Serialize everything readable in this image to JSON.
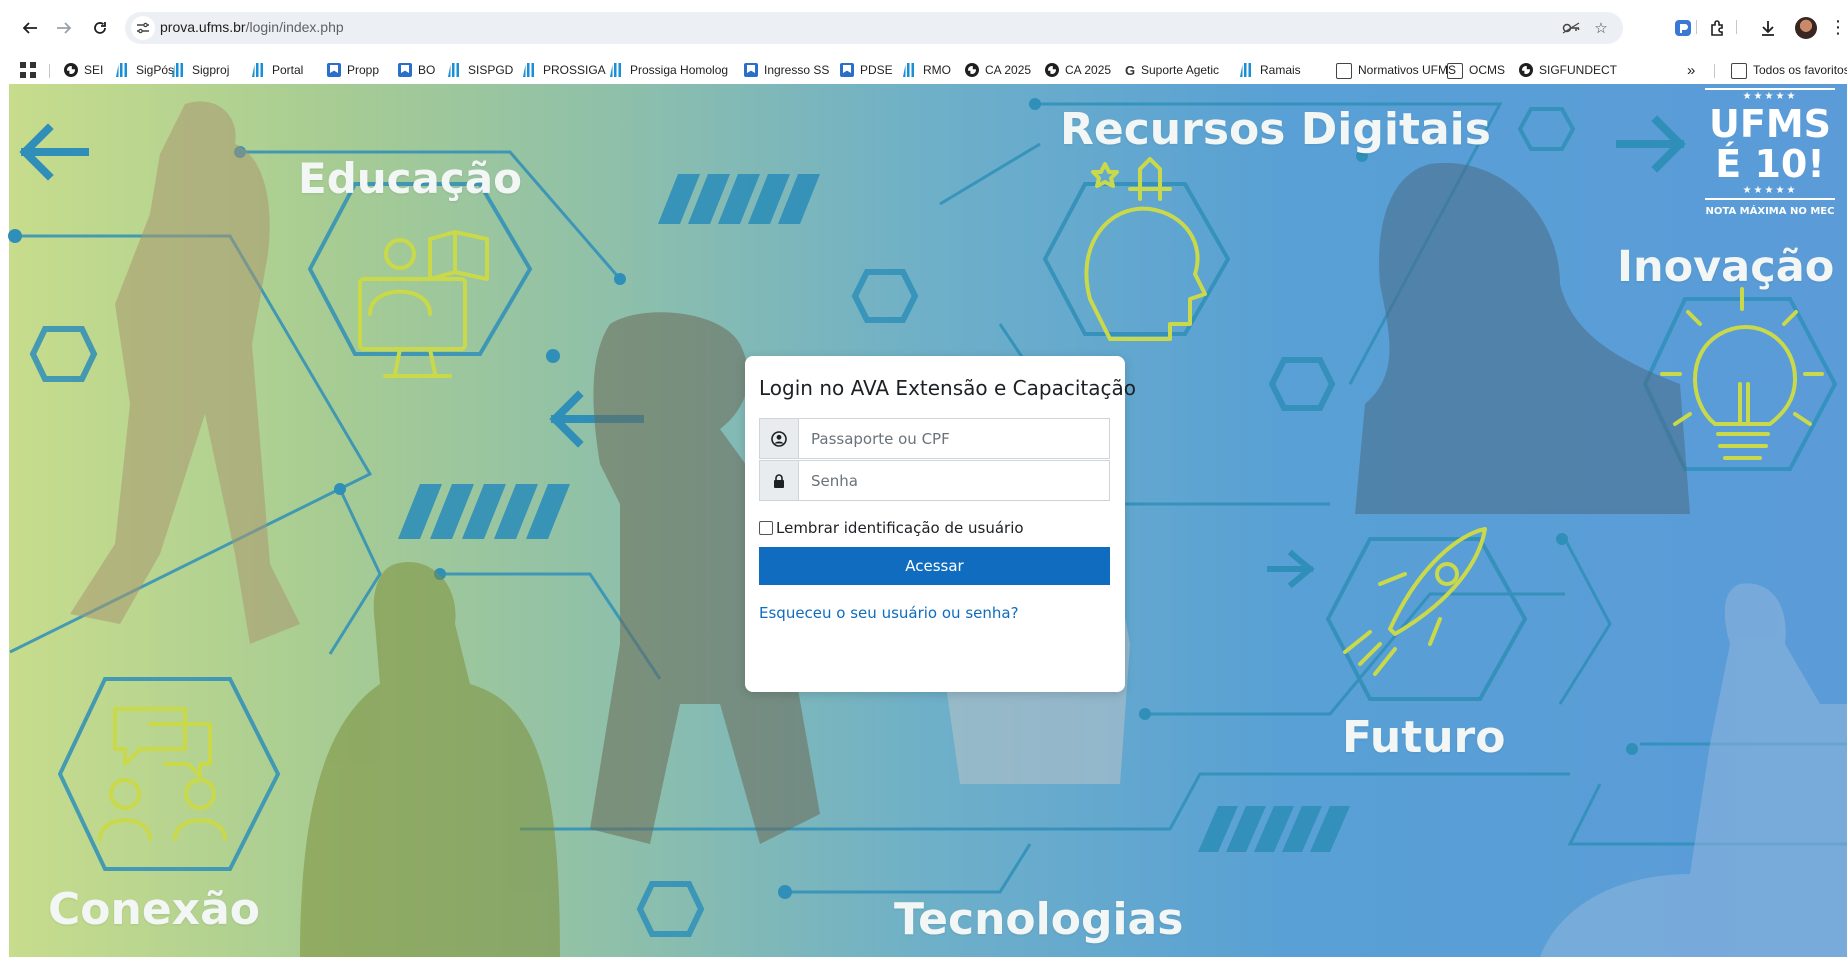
{
  "browser": {
    "url_host": "prova.ufms.br",
    "url_path": "/login/index.php"
  },
  "bookmarks": [
    {
      "label": "SEI",
      "icon": "globe-icon"
    },
    {
      "label": "SigPós",
      "icon": "ufms-icon"
    },
    {
      "label": "Sigproj",
      "icon": "ufms-icon"
    },
    {
      "label": "Portal",
      "icon": "ufms-icon"
    },
    {
      "label": "Propp",
      "icon": "bookmark-icon"
    },
    {
      "label": "BO",
      "icon": "bookmark-icon"
    },
    {
      "label": "SISPGD",
      "icon": "ufms-icon"
    },
    {
      "label": "PROSSIGA",
      "icon": "ufms-icon"
    },
    {
      "label": "Prossiga Homolog",
      "icon": "ufms-icon"
    },
    {
      "label": "Ingresso SS",
      "icon": "bookmark-icon"
    },
    {
      "label": "PDSE",
      "icon": "bookmark-icon"
    },
    {
      "label": "RMO",
      "icon": "ufms-icon"
    },
    {
      "label": "CA 2025",
      "icon": "globe-icon"
    },
    {
      "label": "CA 2025",
      "icon": "globe-icon"
    },
    {
      "label": "Suporte Agetic",
      "icon": "g-icon"
    },
    {
      "label": "Ramais",
      "icon": "ufms-icon"
    },
    {
      "label": "Normativos UFMS",
      "icon": "folder-icon"
    },
    {
      "label": "OCMS",
      "icon": "folder-icon"
    },
    {
      "label": "SIGFUNDECT",
      "icon": "globe-icon"
    }
  ],
  "bookmarks_overflow": "»",
  "all_bookmarks": "Todos os favoritos",
  "background": {
    "words": {
      "educacao": "Educação",
      "recursos": "Recursos Digitais",
      "inovacao": "Inovação",
      "futuro": "Futuro",
      "conexao": "Conexão",
      "tecnologias": "Tecnologias"
    },
    "badge": {
      "stars": "★★★★★",
      "line1": "UFMS",
      "line2": "É 10!",
      "note": "NOTA MÁXIMA NO MEC"
    }
  },
  "login": {
    "title": "Login no AVA Extensão e Capacitação",
    "username_placeholder": "Passaporte ou CPF",
    "username_value": "",
    "password_placeholder": "Senha",
    "password_value": "",
    "remember_label": "Lembrar identificação de usuário",
    "remember_checked": false,
    "submit_label": "Acessar",
    "forgot_link": "Esqueceu o seu usuário ou senha?"
  },
  "colors": {
    "primary": "#0f6cbf",
    "icon_line": "#c9d94a",
    "hex_line": "#2f8fb8"
  }
}
